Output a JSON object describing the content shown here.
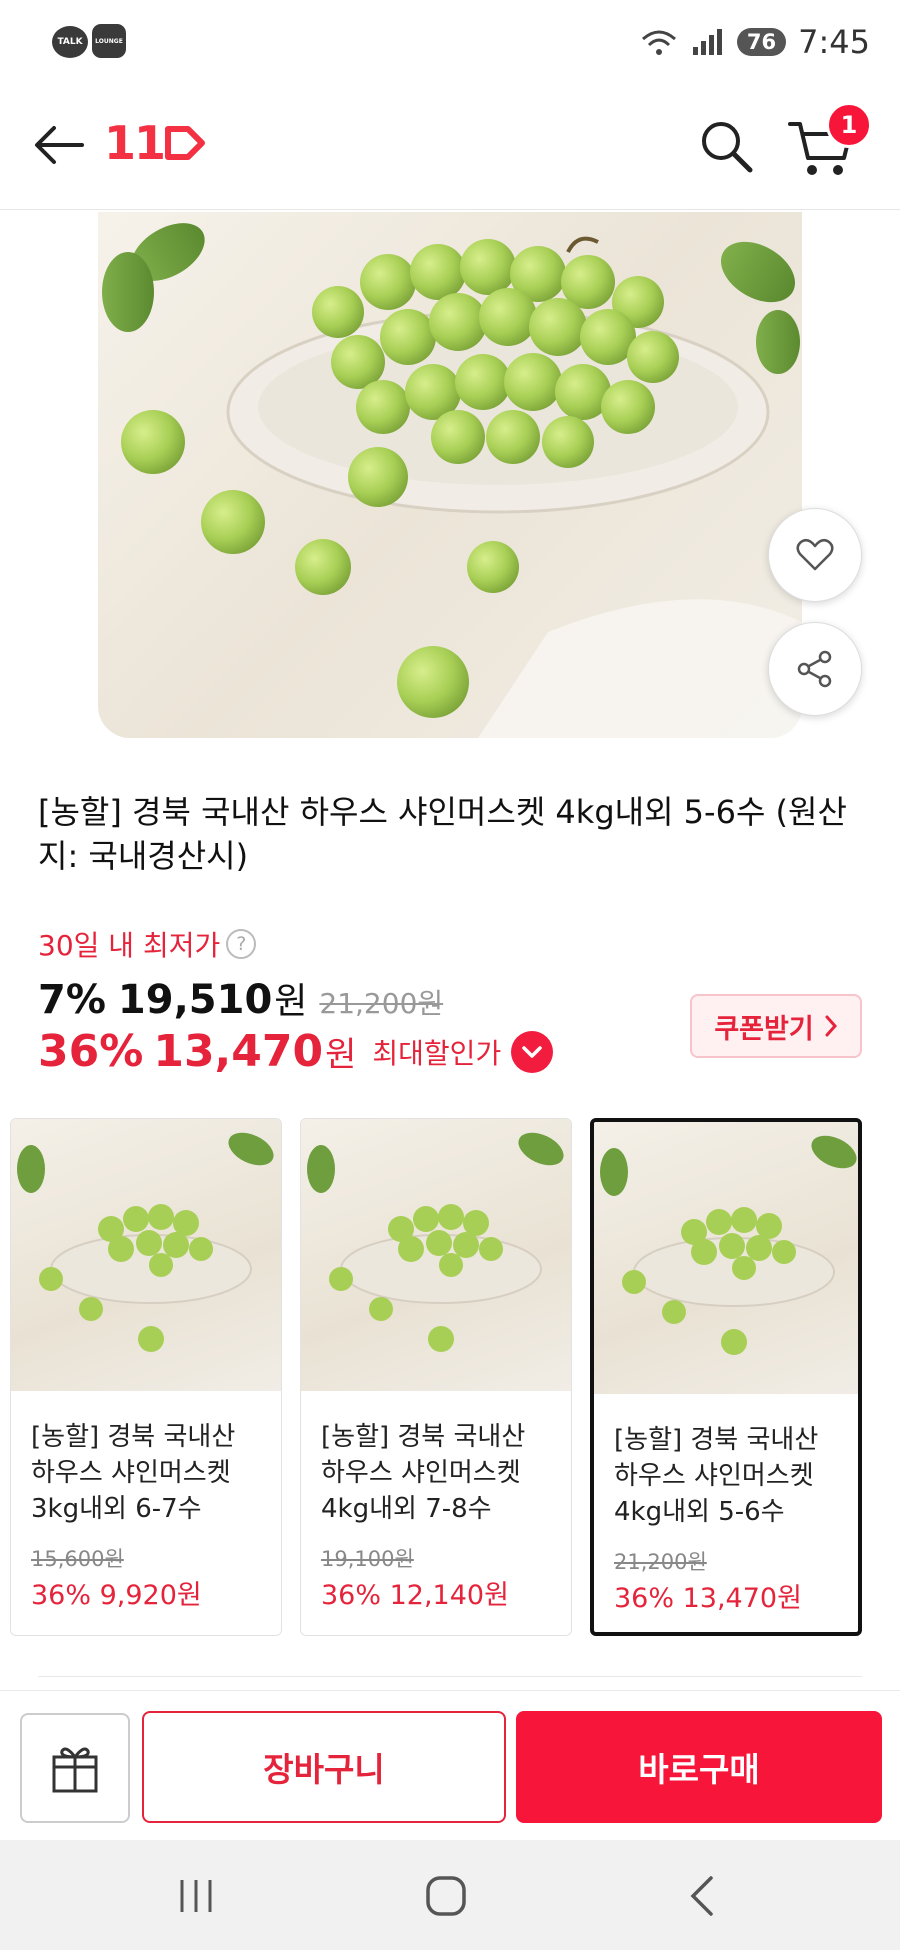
{
  "status_bar": {
    "app1": "TALK",
    "app2": "LOUNGE",
    "battery": "76",
    "time": "7:45"
  },
  "header": {
    "logo": "11",
    "cart_count": "1"
  },
  "product": {
    "title": "[농할] 경북 국내산 하우스 샤인머스켓 4kg내외 5-6수 (원산지: 국내경산시)",
    "lowest_label": "30일 내 최저가",
    "help_icon": "?",
    "discount1": "7%",
    "price1": "19,510",
    "price1_unit": "원",
    "original_price": "21,200원",
    "discount2": "36%",
    "price2": "13,470",
    "price2_unit": "원",
    "max_label": "최대할인가",
    "coupon_label": "쿠폰받기"
  },
  "options": [
    {
      "title": "[농할] 경북 국내산 하우스 샤인머스켓 3kg내외 6-7수",
      "original": "15,600원",
      "price": "36% 9,920원"
    },
    {
      "title": "[농할] 경북 국내산 하우스 샤인머스켓 4kg내외 7-8수",
      "original": "19,100원",
      "price": "36% 12,140원"
    },
    {
      "title": "[농할] 경북 국내산 하우스 샤인머스켓 4kg내외 5-6수",
      "original": "21,200원",
      "price": "36% 13,470원"
    }
  ],
  "bottom_bar": {
    "cart_label": "장바구니",
    "buy_label": "바로구매"
  },
  "colors": {
    "accent": "#f8153a",
    "price_red": "#e5243b",
    "grape": "#a8cf55"
  },
  "icons": [
    "back-arrow-icon",
    "search-icon",
    "cart-icon",
    "heart-icon",
    "share-icon",
    "help-icon",
    "chevron-down-icon",
    "chevron-right-icon",
    "gift-icon",
    "recents-icon",
    "home-icon",
    "back-icon"
  ]
}
